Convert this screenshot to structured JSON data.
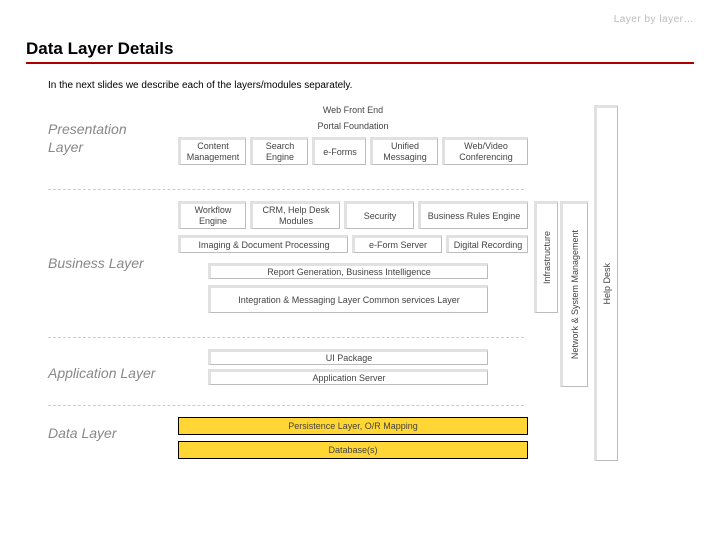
{
  "header": {
    "tagline": "Layer by layer…",
    "title": "Data Layer Details"
  },
  "intro": "In the next slides we describe each of the layers/modules separately.",
  "layers": {
    "presentation": "Presentation Layer",
    "business": "Business Layer",
    "application": "Application Layer",
    "data": "Data Layer"
  },
  "rows": {
    "web_front_end": "Web Front End",
    "portal_foundation": "Portal Foundation",
    "content_mgmt": "Content Management",
    "search_engine": "Search Engine",
    "eforms": "e-Forms",
    "unified_msg": "Unified Messaging",
    "web_video": "Web/Video Conferencing",
    "workflow": "Workflow Engine",
    "crm_help": "CRM, Help Desk Modules",
    "security": "Security",
    "biz_rules": "Business Rules Engine",
    "img_doc": "Imaging & Document Processing",
    "eform_srv": "e-Form Server",
    "dig_rec": "Digital Recording",
    "report": "Report Generation, Business Intelligence",
    "integ": "Integration & Messaging Layer Common services Layer",
    "ui_pkg": "UI Package",
    "app_srv": "Application Server",
    "persist": "Persistence Layer, O/R Mapping",
    "db": "Database(s)"
  },
  "verticals": {
    "infra": "Infrastructure",
    "netsys": "Network & System Management",
    "help": "Help Desk"
  }
}
